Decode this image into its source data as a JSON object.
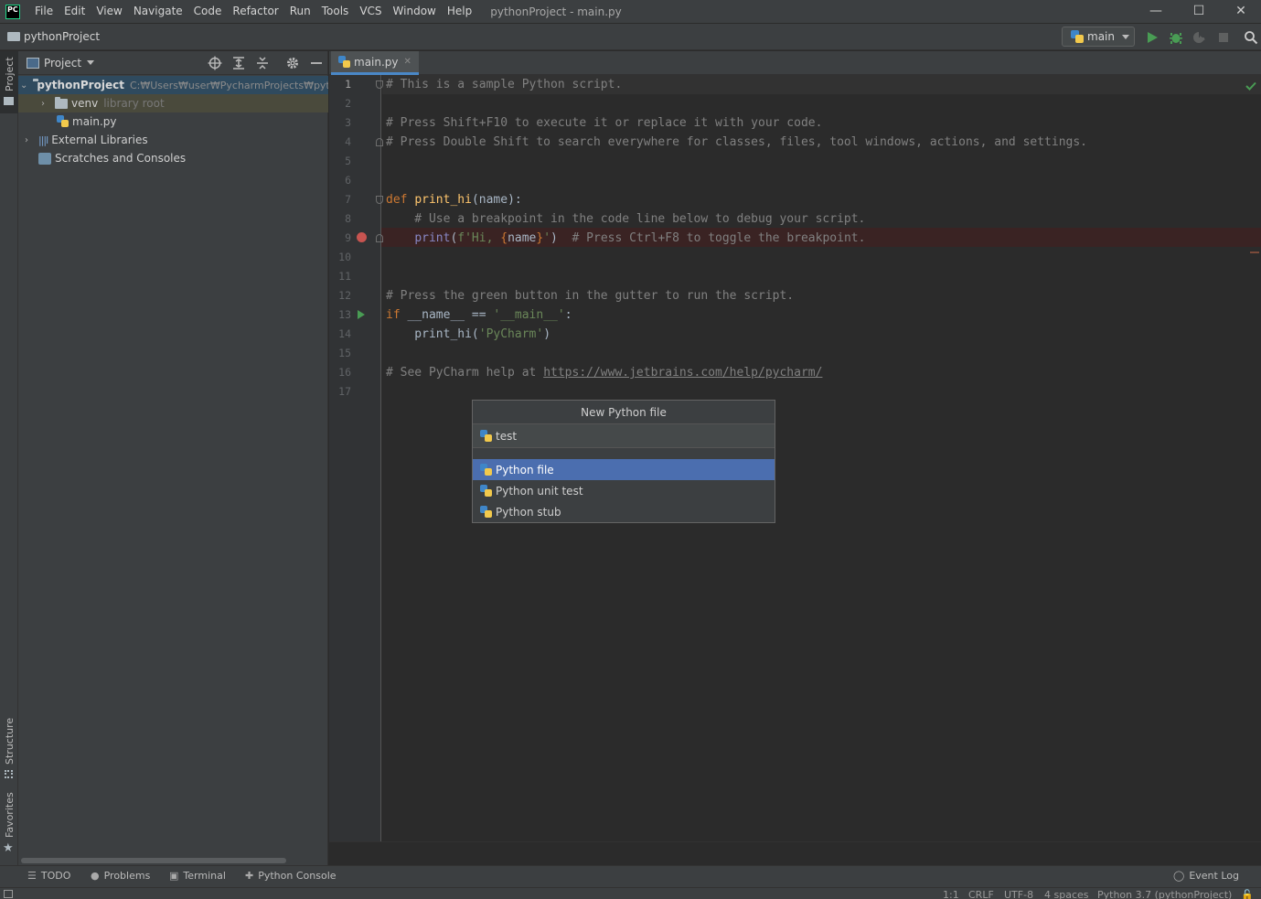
{
  "menu": {
    "logo": "PC",
    "items": [
      "File",
      "Edit",
      "View",
      "Navigate",
      "Code",
      "Refactor",
      "Run",
      "Tools",
      "VCS",
      "Window",
      "Help"
    ],
    "window_title": "pythonProject - main.py"
  },
  "window_controls": {
    "minimize": "—",
    "maximize": "☐",
    "close": "✕"
  },
  "navbar": {
    "project": "pythonProject",
    "run_config": "main"
  },
  "left_stripe": {
    "project": "Project",
    "structure": "Structure",
    "favorites": "Favorites"
  },
  "project_panel": {
    "view_label": "Project",
    "tree": [
      {
        "label": "pythonProject",
        "path": "C:₩Users₩user₩PycharmProjects₩pythonProject"
      },
      {
        "label": "venv",
        "hint": "library root"
      },
      {
        "label": "main.py"
      },
      {
        "label": "External Libraries"
      },
      {
        "label": "Scratches and Consoles"
      }
    ]
  },
  "editor": {
    "tab": "main.py",
    "line_numbers": [
      "1",
      "2",
      "3",
      "4",
      "5",
      "6",
      "7",
      "8",
      "9",
      "10",
      "11",
      "12",
      "13",
      "14",
      "15",
      "16",
      "17"
    ],
    "lines": {
      "l1": "# This is a sample Python script.",
      "l3": "# Press Shift+F10 to execute it or replace it with your code.",
      "l4": "# Press Double Shift to search everywhere for classes, files, tool windows, actions, and settings.",
      "l7_kw": "def ",
      "l7_fn": "print_hi",
      "l7_rest": "(name):",
      "l8": "    # Use a breakpoint in the code line below to debug your script.",
      "l9_indent": "    ",
      "l9_bi": "print",
      "l9_p1": "(",
      "l9_s1": "f'Hi, ",
      "l9_b1": "{",
      "l9_v": "name",
      "l9_b2": "}",
      "l9_s2": "'",
      "l9_p2": ")",
      "l9_cmt": "  # Press Ctrl+F8 to toggle the breakpoint.",
      "l12": "# Press the green button in the gutter to run the script.",
      "l13_kw": "if ",
      "l13_a": "__name__ == ",
      "l13_s": "'__main__'",
      "l13_b": ":",
      "l14_a": "    print_hi(",
      "l14_s": "'PyCharm'",
      "l14_b": ")",
      "l16_a": "# See PyCharm help at ",
      "l16_link": "https://www.jetbrains.com/help/pycharm/"
    }
  },
  "popup": {
    "title": "New Python file",
    "input_value": "test",
    "items": [
      "Python file",
      "Python unit test",
      "Python stub"
    ],
    "selected_index": 0
  },
  "bottom_tools": {
    "todo": "TODO",
    "problems": "Problems",
    "terminal": "Terminal",
    "python_console": "Python Console",
    "event_log": "Event Log"
  },
  "status": {
    "position": "1:1",
    "line_sep": "CRLF",
    "encoding": "UTF-8",
    "indent": "4 spaces",
    "interpreter": "Python 3.7 (pythonProject)"
  }
}
